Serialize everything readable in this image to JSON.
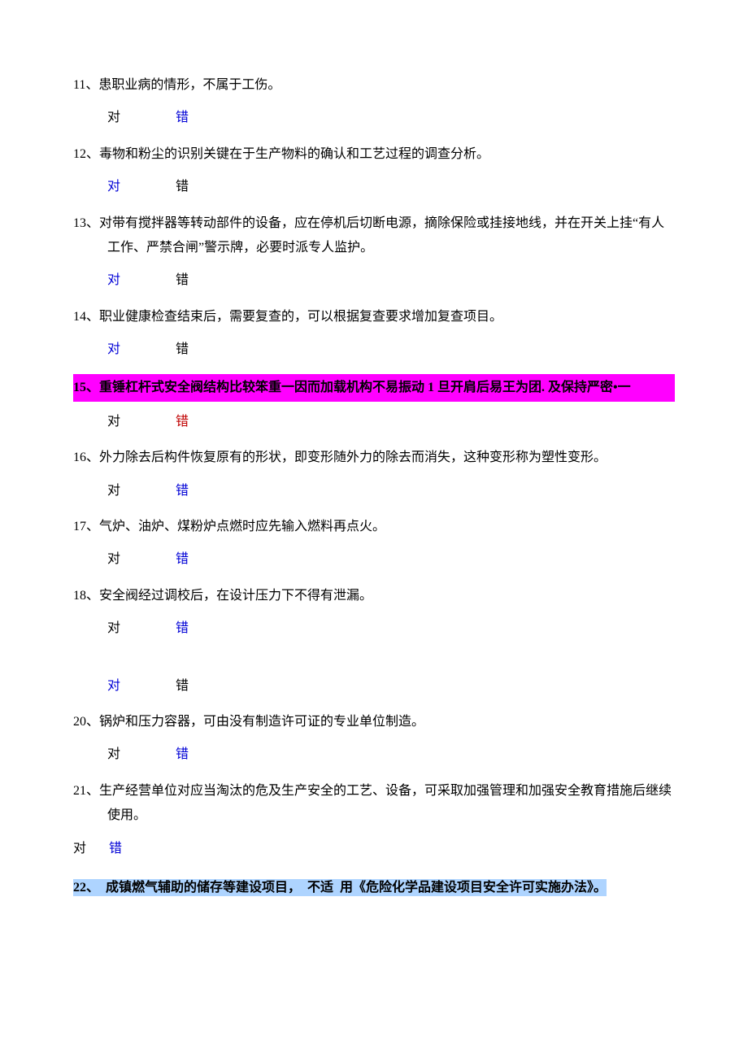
{
  "questions": {
    "q11": {
      "num": "11、",
      "text": "患职业病的情形，不属于工伤。",
      "ans_true": "对",
      "ans_false": "错"
    },
    "q12": {
      "num": "12、",
      "text": "毒物和粉尘的识别关键在于生产物料的确认和工艺过程的调查分析。",
      "ans_true": "对",
      "ans_false": "错"
    },
    "q13": {
      "num": "13、",
      "text": "对带有搅拌器等转动部件的设备，应在停机后切断电源，摘除保险或挂接地线，并在开关上挂“有人工作、严禁合闸”警示牌，必要时派专人监护。",
      "ans_true": "对",
      "ans_false": "错"
    },
    "q14": {
      "num": "14、",
      "text": "职业健康检查结束后，需要复查的，可以根据复查要求增加复查项目。",
      "ans_true": "对",
      "ans_false": "错"
    },
    "q15": {
      "num": "15、",
      "text_hl": "重锤杠杆式安全阀结构比较笨重一因而加载机构不易振动 1 旦开肩后易王为团. 及保持严密•一",
      "ans_true": "对",
      "ans_false": "错"
    },
    "q16": {
      "num": "16、",
      "text": "外力除去后构件恢复原有的形状，即变形随外力的除去而消失，这种变形称为塑性变形。",
      "ans_true": "对",
      "ans_false": "错"
    },
    "q17": {
      "num": "17、",
      "text": "气炉、油炉、煤粉炉点燃时应先输入燃料再点火。",
      "ans_true": "对",
      "ans_false": "错"
    },
    "q18": {
      "num": "18、",
      "text": "安全阀经过调校后，在设计压力下不得有泄漏。",
      "ans_true": "对",
      "ans_false": "错"
    },
    "q19": {
      "ans_true": "对",
      "ans_false": "错"
    },
    "q20": {
      "num": "20、",
      "text": "锅炉和压力容器，可由没有制造许可证的专业单位制造。",
      "ans_true": "对",
      "ans_false": "错"
    },
    "q21": {
      "num": "21、",
      "text": "生产经营单位对应当淘汰的危及生产安全的工艺、设备，可采取加强管理和加强安全教育措施后继续使用。",
      "ans_true": "对",
      "ans_false": "错"
    },
    "q22": {
      "num": "22、",
      "part1": "成镇燃气辅助的储存等建设项目，",
      "part2": "不适",
      "part3": "用《危险化学品建设项目安全许可实施办法》。"
    }
  }
}
